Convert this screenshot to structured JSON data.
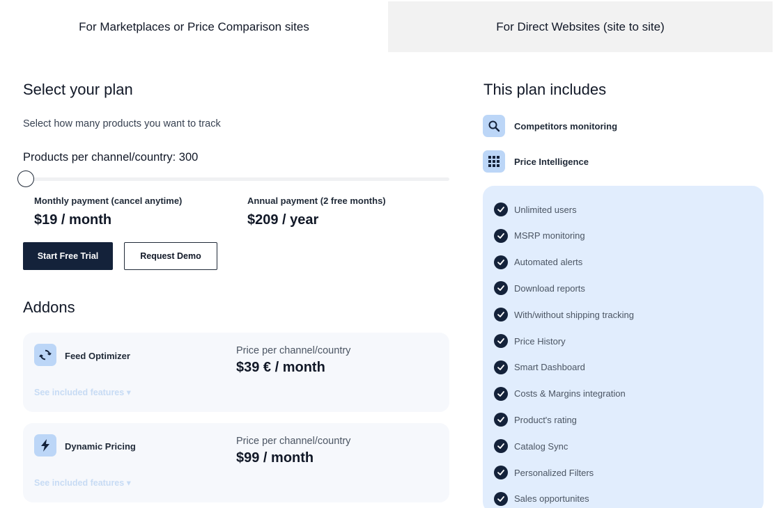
{
  "tabs": [
    {
      "label": "For Marketplaces or Price Comparison sites",
      "active": true
    },
    {
      "label": "For Direct Websites (site to site)",
      "active": false
    }
  ],
  "plan": {
    "title": "Select your plan",
    "subtitle": "Select how many products you want to track",
    "products_label": "Products per channel/country: 300",
    "slider_level": 0
  },
  "payments": {
    "monthly_label": "Monthly payment (cancel anytime)",
    "monthly_price": "$19 / month",
    "annual_label": "Annual payment (2 free months)",
    "annual_price": "$209 / year"
  },
  "buttons": {
    "start_trial": "Start Free Trial",
    "request_demo": "Request Demo"
  },
  "addons": {
    "title": "Addons",
    "items": [
      {
        "icon": "refresh-icon",
        "name": "Feed Optimizer",
        "price_label": "Price per channel/country",
        "price": "$39 € / month",
        "see": "See included features ▾"
      },
      {
        "icon": "lightning-icon",
        "name": "Dynamic Pricing",
        "price_label": "Price per channel/country",
        "price": "$99 / month",
        "see": "See included features ▾"
      }
    ]
  },
  "includes": {
    "title": "This plan includes",
    "items": [
      {
        "icon": "search-icon",
        "label": "Competitors monitoring"
      },
      {
        "icon": "grid-icon",
        "label": "Price Intelligence"
      }
    ],
    "features": [
      "Unlimited users",
      "MSRP monitoring",
      "Automated alerts",
      "Download reports",
      "With/without shipping tracking",
      "Price History",
      "Smart Dashboard",
      "Costs & Margins integration",
      "Product's rating",
      "Catalog Sync",
      "Personalized Filters",
      "Sales opportunites"
    ]
  },
  "colors": {
    "navy": "#14223a",
    "icon_bg": "#bcd6f7",
    "features_bg": "#e1edfd",
    "inactive_tab": "#f2f2f2"
  }
}
